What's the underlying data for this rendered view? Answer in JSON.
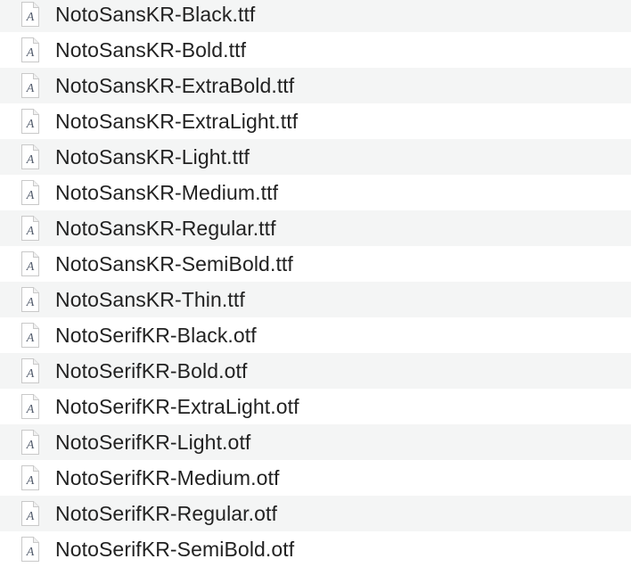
{
  "files": [
    {
      "name": "NotoSansKR-Black.ttf",
      "icon": "font-file-icon"
    },
    {
      "name": "NotoSansKR-Bold.ttf",
      "icon": "font-file-icon"
    },
    {
      "name": "NotoSansKR-ExtraBold.ttf",
      "icon": "font-file-icon"
    },
    {
      "name": "NotoSansKR-ExtraLight.ttf",
      "icon": "font-file-icon"
    },
    {
      "name": "NotoSansKR-Light.ttf",
      "icon": "font-file-icon"
    },
    {
      "name": "NotoSansKR-Medium.ttf",
      "icon": "font-file-icon"
    },
    {
      "name": "NotoSansKR-Regular.ttf",
      "icon": "font-file-icon"
    },
    {
      "name": "NotoSansKR-SemiBold.ttf",
      "icon": "font-file-icon"
    },
    {
      "name": "NotoSansKR-Thin.ttf",
      "icon": "font-file-icon"
    },
    {
      "name": "NotoSerifKR-Black.otf",
      "icon": "font-file-icon"
    },
    {
      "name": "NotoSerifKR-Bold.otf",
      "icon": "font-file-icon"
    },
    {
      "name": "NotoSerifKR-ExtraLight.otf",
      "icon": "font-file-icon"
    },
    {
      "name": "NotoSerifKR-Light.otf",
      "icon": "font-file-icon"
    },
    {
      "name": "NotoSerifKR-Medium.otf",
      "icon": "font-file-icon"
    },
    {
      "name": "NotoSerifKR-Regular.otf",
      "icon": "font-file-icon"
    },
    {
      "name": "NotoSerifKR-SemiBold.otf",
      "icon": "font-file-icon"
    }
  ],
  "colors": {
    "row_alt": "#f4f5f5",
    "row": "#ffffff",
    "text": "#222222"
  }
}
